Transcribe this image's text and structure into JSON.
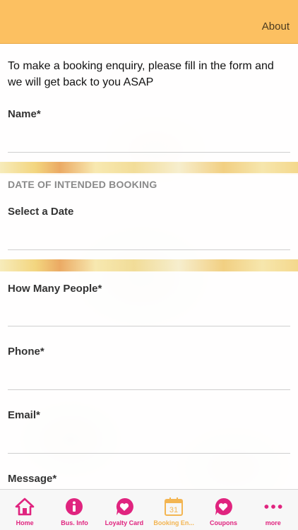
{
  "header": {
    "about_label": "About"
  },
  "form": {
    "intro": "To make a booking enquiry, please fill in the form and we will get back to you ASAP",
    "name_label": "Name*",
    "date_section_heading": "DATE OF INTENDED BOOKING",
    "date_label": "Select a Date",
    "people_label": "How Many People*",
    "phone_label": "Phone*",
    "email_label": "Email*",
    "message_label": "Message*"
  },
  "tabbar": {
    "tabs": [
      {
        "label": "Home",
        "icon": "home-icon"
      },
      {
        "label": "Bus. Info",
        "icon": "info-icon"
      },
      {
        "label": "Loyalty Card",
        "icon": "heart-bubble-icon"
      },
      {
        "label": "Booking En...",
        "icon": "calendar-icon",
        "icon_text": "31"
      },
      {
        "label": "Coupons",
        "icon": "heart-bubble-icon"
      },
      {
        "label": "more",
        "icon": "more-icon"
      }
    ],
    "active_index": 3
  },
  "colors": {
    "header": "#fcc061",
    "accent_pink": "#e0247f",
    "active_tab": "#f3b552"
  }
}
